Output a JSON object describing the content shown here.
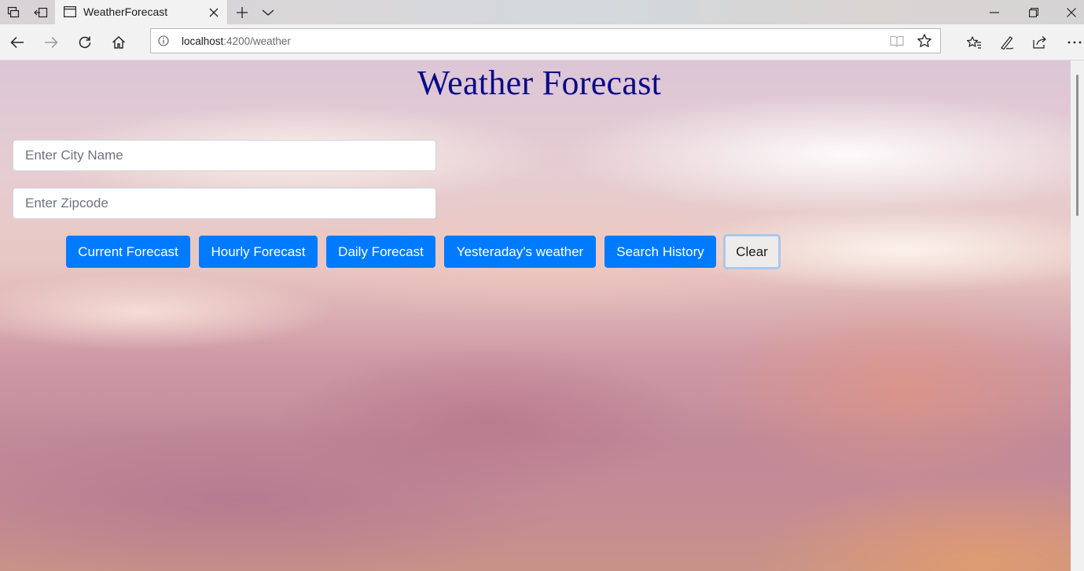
{
  "browser": {
    "tab_title": "WeatherForecast",
    "url_host": "localhost",
    "url_path": ":4200/weather"
  },
  "page": {
    "title": "Weather Forecast",
    "city_placeholder": "Enter City Name",
    "zip_placeholder": "Enter Zipcode",
    "buttons": {
      "current": "Current Forecast",
      "hourly": "Hourly Forecast",
      "daily": "Daily Forecast",
      "yesterday": "Yesteraday's weather",
      "history": "Search History",
      "clear": "Clear"
    }
  },
  "colors": {
    "primary_button": "#007bff",
    "title": "#0a0a8a"
  }
}
